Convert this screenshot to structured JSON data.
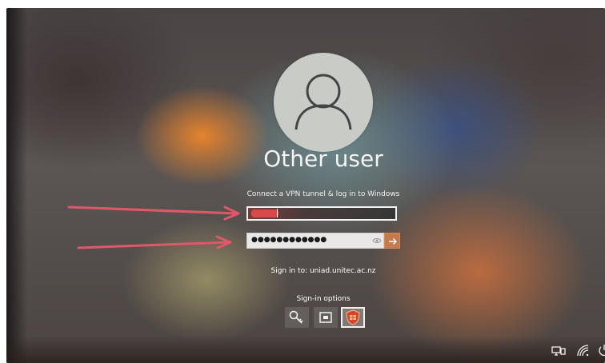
{
  "login": {
    "username": "Other user",
    "connect_label": "Connect a VPN tunnel & log in to Windows",
    "username_field": {
      "value": ""
    },
    "password_field": {
      "masked_value": "●●●●●●●●●●●●"
    },
    "sign_in_to": "Sign in to: uniad.unitec.ac.nz",
    "sign_in_options_label": "Sign-in options"
  },
  "icons": {
    "avatar": "user-avatar-icon",
    "reveal": "eye-icon",
    "submit": "arrow-right-icon",
    "options": [
      "key-icon",
      "pin-icon",
      "certificate-icon"
    ],
    "tray": [
      "network-icon",
      "wifi-icon",
      "power-icon"
    ]
  },
  "colors": {
    "submit_button": "#c6794a",
    "annotation_arrow": "#e0576a",
    "text": "#ffffff",
    "avatar_bg": "#c9cbc6"
  }
}
